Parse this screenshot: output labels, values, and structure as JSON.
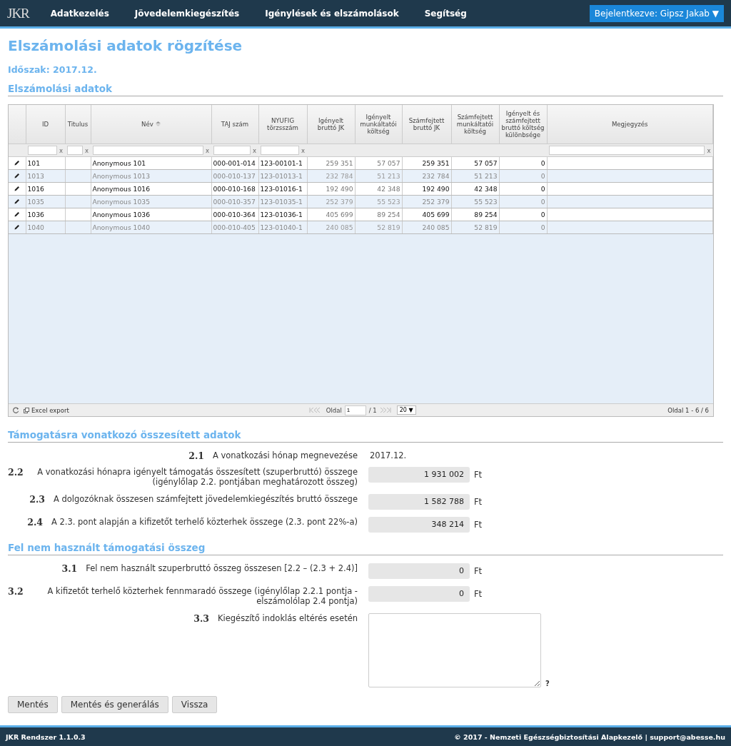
{
  "app": {
    "logo": "JKR",
    "nav": [
      "Adatkezelés",
      "Jövedelemkiegészítés",
      "Igénylések és elszámolások",
      "Segítség"
    ],
    "user": "Bejelentkezve: Gipsz Jakab ▼"
  },
  "page": {
    "title": "Elszámolási adatok rögzítése",
    "period": "Időszak: 2017.12.",
    "table_heading": "Elszámolási adatok"
  },
  "table": {
    "columns": [
      {
        "label": "ID",
        "filter_clear": "x",
        "sorted": false,
        "muted": false,
        "kind": "text"
      },
      {
        "label": "Titulus",
        "filter_clear": "x",
        "sorted": false,
        "kind": "text"
      },
      {
        "label": "Név",
        "filter_clear": "x",
        "sorted": true,
        "muted": false,
        "kind": "text"
      },
      {
        "label": "TAJ szám",
        "filter_clear": "x",
        "sorted": false,
        "muted": false,
        "kind": "text"
      },
      {
        "label": "NYUFIG törzsszám",
        "filter_clear": "x",
        "sorted": false,
        "muted": false,
        "kind": "text"
      },
      {
        "label": "Igényelt bruttó JK",
        "sorted": false,
        "muted": true,
        "kind": "number"
      },
      {
        "label": "Igényelt munkáltatói költség",
        "sorted": false,
        "muted": true,
        "kind": "number"
      },
      {
        "label": "Számfejtett bruttó JK",
        "sorted": false,
        "muted": false,
        "kind": "number"
      },
      {
        "label": "Számfejtett munkáltatói költség",
        "sorted": false,
        "muted": false,
        "kind": "number"
      },
      {
        "label": "Igényelt és számfejtett bruttó költség különbsége",
        "sorted": false,
        "muted": false,
        "kind": "number"
      },
      {
        "label": "Megjegyzés",
        "filter_clear": "x",
        "sorted": false,
        "kind": "text"
      }
    ],
    "rows": [
      {
        "dimmed": false,
        "cells": [
          "101",
          null,
          "Anonymous 101",
          "000-001-014",
          "123-00101-1",
          "259 351",
          "57 057",
          "259 351",
          "57 057",
          "0",
          null
        ]
      },
      {
        "dimmed": true,
        "cells": [
          "1013",
          null,
          "Anonymous 1013",
          "000-010-137",
          "123-01013-1",
          "232 784",
          "51 213",
          "232 784",
          "51 213",
          "0",
          null
        ]
      },
      {
        "dimmed": false,
        "cells": [
          "1016",
          null,
          "Anonymous 1016",
          "000-010-168",
          "123-01016-1",
          "192 490",
          "42 348",
          "192 490",
          "42 348",
          "0",
          null
        ]
      },
      {
        "dimmed": true,
        "cells": [
          "1035",
          null,
          "Anonymous 1035",
          "000-010-357",
          "123-01035-1",
          "252 379",
          "55 523",
          "252 379",
          "55 523",
          "0",
          null
        ]
      },
      {
        "dimmed": false,
        "cells": [
          "1036",
          null,
          "Anonymous 1036",
          "000-010-364",
          "123-01036-1",
          "405 699",
          "89 254",
          "405 699",
          "89 254",
          "0",
          null
        ]
      },
      {
        "dimmed": true,
        "cells": [
          "1040",
          null,
          "Anonymous 1040",
          "000-010-405",
          "123-01040-1",
          "240 085",
          "52 819",
          "240 085",
          "52 819",
          "0",
          null
        ]
      }
    ],
    "footer": {
      "export": "Excel export",
      "page_label": "Oldal",
      "page": "1",
      "page_total": "/ 1",
      "page_size": "20 ▼",
      "summary": "Oldal 1 - 6 / 6"
    }
  },
  "sections": [
    {
      "heading": "Támogatásra vonatkozó összesített adatok",
      "items": [
        {
          "num": "2.1",
          "label": "A vonatkozási hónap megnevezése",
          "kind": "text",
          "value": "2017.12."
        },
        {
          "num": "2.2",
          "label": "A vonatkozási hónapra igényelt támogatás összesített (szuperbruttó) összege (igénylőlap 2.2. pontjában meghatározott összeg)",
          "kind": "amount",
          "value": "1 931 002",
          "unit": "Ft"
        },
        {
          "num": "2.3",
          "label": "A dolgozóknak összesen számfejtett jövedelemkiegészítés bruttó összege",
          "kind": "amount",
          "value": "1 582 788",
          "unit": "Ft"
        },
        {
          "num": "2.4",
          "label": "A 2.3. pont alapján a kifizetőt terhelő közterhek összege (2.3. pont 22%-a)",
          "kind": "amount",
          "value": "348 214",
          "unit": "Ft"
        }
      ]
    },
    {
      "heading": "Fel nem használt támogatási összeg",
      "items": [
        {
          "num": "3.1",
          "label": "Fel nem használt szuperbruttó összeg összesen [2.2 – (2.3 + 2.4)]",
          "kind": "amount",
          "value": "0",
          "unit": "Ft"
        },
        {
          "num": "3.2",
          "label": "A kifizetőt terhelő közterhek fennmaradó összege (igénylőlap 2.2.1 pontja - elszámolólap 2.4 pontja)",
          "kind": "amount",
          "value": "0",
          "unit": "Ft"
        },
        {
          "num": "3.3",
          "label": "Kiegészítő indoklás eltérés esetén",
          "kind": "textarea",
          "help": "?"
        }
      ]
    }
  ],
  "buttons": [
    "Mentés",
    "Mentés és generálás",
    "Vissza"
  ],
  "footer": {
    "left": "JKR Rendszer 1.1.0.3",
    "right": "© 2017 - Nemzeti Egészségbiztosítási Alapkezelő | support@abesse.hu"
  }
}
